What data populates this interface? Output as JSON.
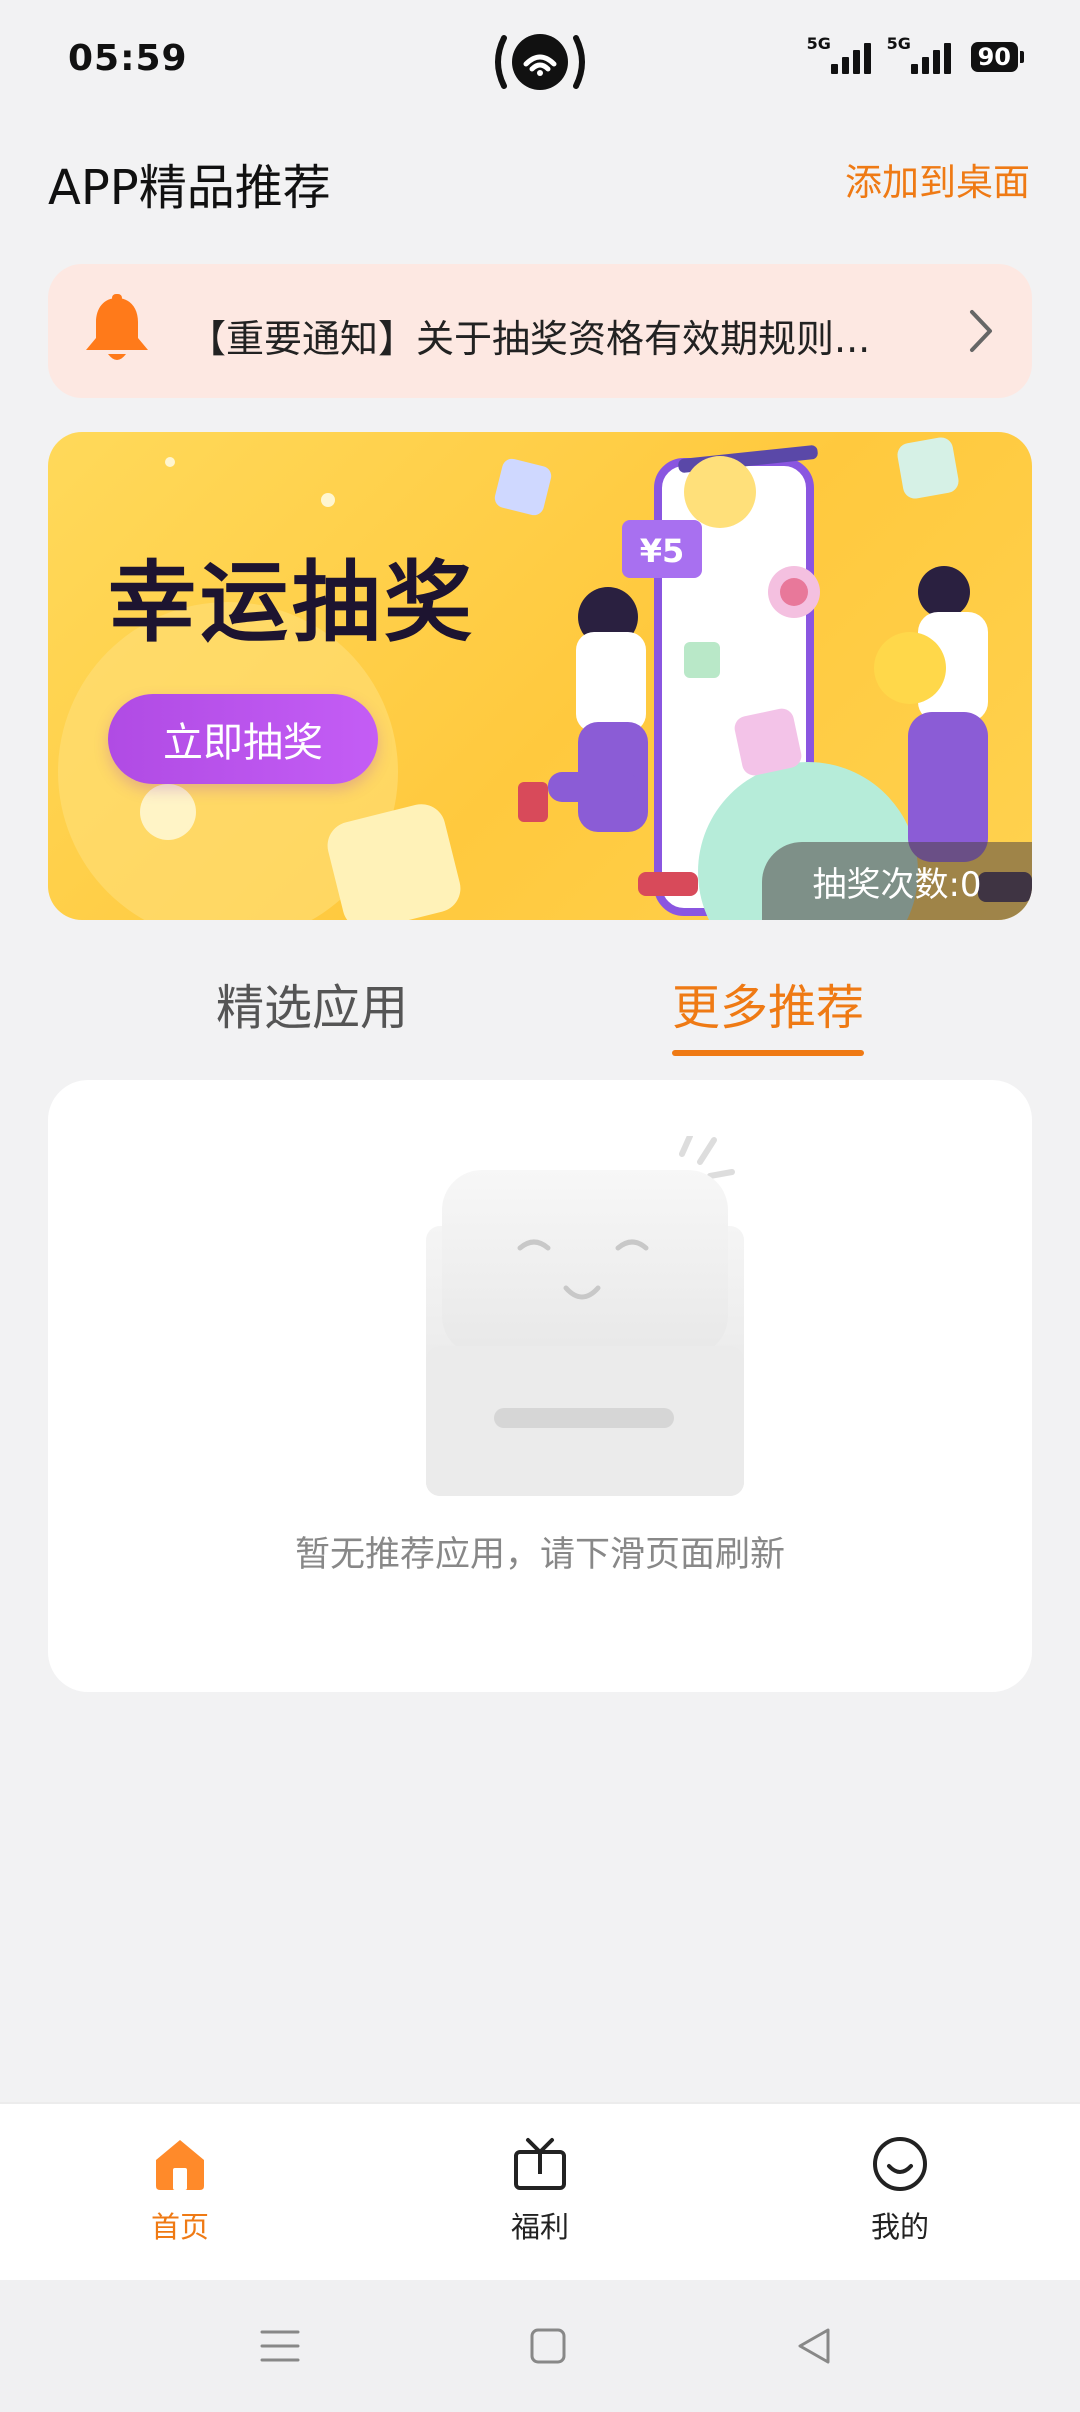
{
  "status_bar": {
    "time": "05:59",
    "network_1": "5G",
    "network_2": "5G",
    "battery": "90"
  },
  "header": {
    "title": "APP精品推荐",
    "add_to_desktop": "添加到桌面"
  },
  "notice": {
    "text": "【重要通知】关于抽奖资格有效期规则..."
  },
  "banner": {
    "title": "幸运抽奖",
    "button_label": "立即抽奖",
    "draw_count": "抽奖次数:0",
    "coupon": "¥5"
  },
  "tabs": [
    {
      "label": "精选应用",
      "active": false
    },
    {
      "label": "更多推荐",
      "active": true
    }
  ],
  "empty_state": {
    "message": "暂无推荐应用，请下滑页面刷新"
  },
  "bottom_nav": [
    {
      "label": "首页",
      "icon": "home-icon",
      "active": true
    },
    {
      "label": "福利",
      "icon": "tv-gift-icon",
      "active": false
    },
    {
      "label": "我的",
      "icon": "smile-face-icon",
      "active": false
    }
  ],
  "colors": {
    "accent": "#ef7a14",
    "banner_yellow": "#ffc93e",
    "button_purple": "#b04be4",
    "notice_bg": "#fde8e2"
  }
}
